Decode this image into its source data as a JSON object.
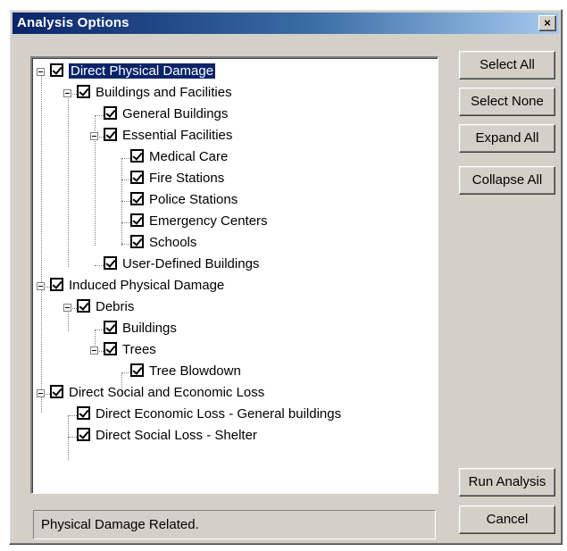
{
  "window": {
    "title": "Analysis Options",
    "close_label": "×"
  },
  "tree": {
    "items": [
      {
        "label": "Direct Physical Damage",
        "checked": true,
        "selected": true
      },
      {
        "label": "Buildings and Facilities",
        "checked": true
      },
      {
        "label": "General Buildings",
        "checked": true
      },
      {
        "label": "Essential Facilities",
        "checked": true
      },
      {
        "label": "Medical Care",
        "checked": true
      },
      {
        "label": "Fire Stations",
        "checked": true
      },
      {
        "label": "Police Stations",
        "checked": true
      },
      {
        "label": "Emergency Centers",
        "checked": true
      },
      {
        "label": "Schools",
        "checked": true
      },
      {
        "label": "User-Defined Buildings",
        "checked": true
      },
      {
        "label": "Induced Physical Damage",
        "checked": true
      },
      {
        "label": "Debris",
        "checked": true
      },
      {
        "label": "Buildings",
        "checked": true
      },
      {
        "label": "Trees",
        "checked": true
      },
      {
        "label": "Tree Blowdown",
        "checked": true
      },
      {
        "label": "Direct Social and Economic Loss",
        "checked": true
      },
      {
        "label": "Direct Economic Loss - General buildings",
        "checked": true
      },
      {
        "label": "Direct Social Loss - Shelter",
        "checked": true
      }
    ]
  },
  "buttons": {
    "select_all": "Select All",
    "select_none": "Select None",
    "expand_all": "Expand All",
    "collapse_all": "Collapse All",
    "run_analysis": "Run Analysis",
    "cancel": "Cancel"
  },
  "status": {
    "text": "Physical Damage Related."
  },
  "colors": {
    "dialog_face": "#d4d0c8",
    "title_bar_start": "#0a246a",
    "title_bar_end": "#a6caf0",
    "selection_bg": "#0a246a",
    "selection_text": "#ffffff"
  }
}
